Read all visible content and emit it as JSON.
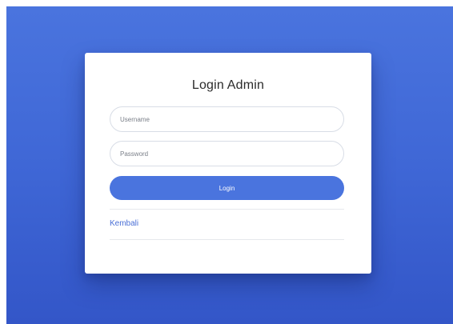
{
  "login_card": {
    "title": "Login Admin",
    "username_placeholder": "Username",
    "password_placeholder": "Password",
    "login_button_label": "Login",
    "back_link_label": "Kembali"
  },
  "colors": {
    "background_gradient_top": "#4a74de",
    "background_gradient_bottom": "#3356c8",
    "accent": "#4a74de",
    "link": "#4a6fd6",
    "card": "#ffffff"
  }
}
